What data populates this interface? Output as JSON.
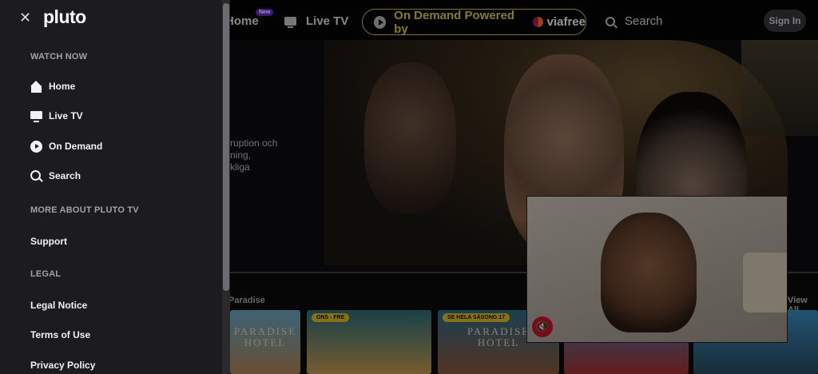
{
  "topnav": {
    "home_label": "Home",
    "home_badge": "New",
    "livetv_label": "Live TV",
    "ondemand_label": "On Demand Powered by",
    "ondemand_partner": "viafree",
    "search_label": "Search",
    "signin_label": "Sign In"
  },
  "hero": {
    "description": "ruption och\nning,\nkliga"
  },
  "row": {
    "title": "Paradise",
    "viewall": "View All",
    "tiles": [
      {
        "title": "PARADISE\nHOTEL",
        "badge": ""
      },
      {
        "title": "",
        "badge": "ONS - FRE"
      },
      {
        "title": "PARADISE\nHOTEL",
        "badge": "SE HELA SÄSONG 17"
      }
    ]
  },
  "menu": {
    "logo": "pluto",
    "watch_now_heading": "WATCH NOW",
    "items": [
      {
        "label": "Home",
        "icon": "home-icon"
      },
      {
        "label": "Live TV",
        "icon": "tv-icon"
      },
      {
        "label": "On Demand",
        "icon": "play-icon"
      },
      {
        "label": "Search",
        "icon": "search-icon"
      }
    ],
    "more_heading": "MORE ABOUT PLUTO TV",
    "support_label": "Support",
    "legal_heading": "LEGAL",
    "legal_notice_label": "Legal Notice",
    "terms_label": "Terms of Use",
    "privacy_label": "Privacy Policy"
  },
  "colors": {
    "accent_yellow": "#e3d24f",
    "menu_bg": "#1c1c1f",
    "mute_red": "#c9182b",
    "new_badge": "#6a2cd8"
  }
}
